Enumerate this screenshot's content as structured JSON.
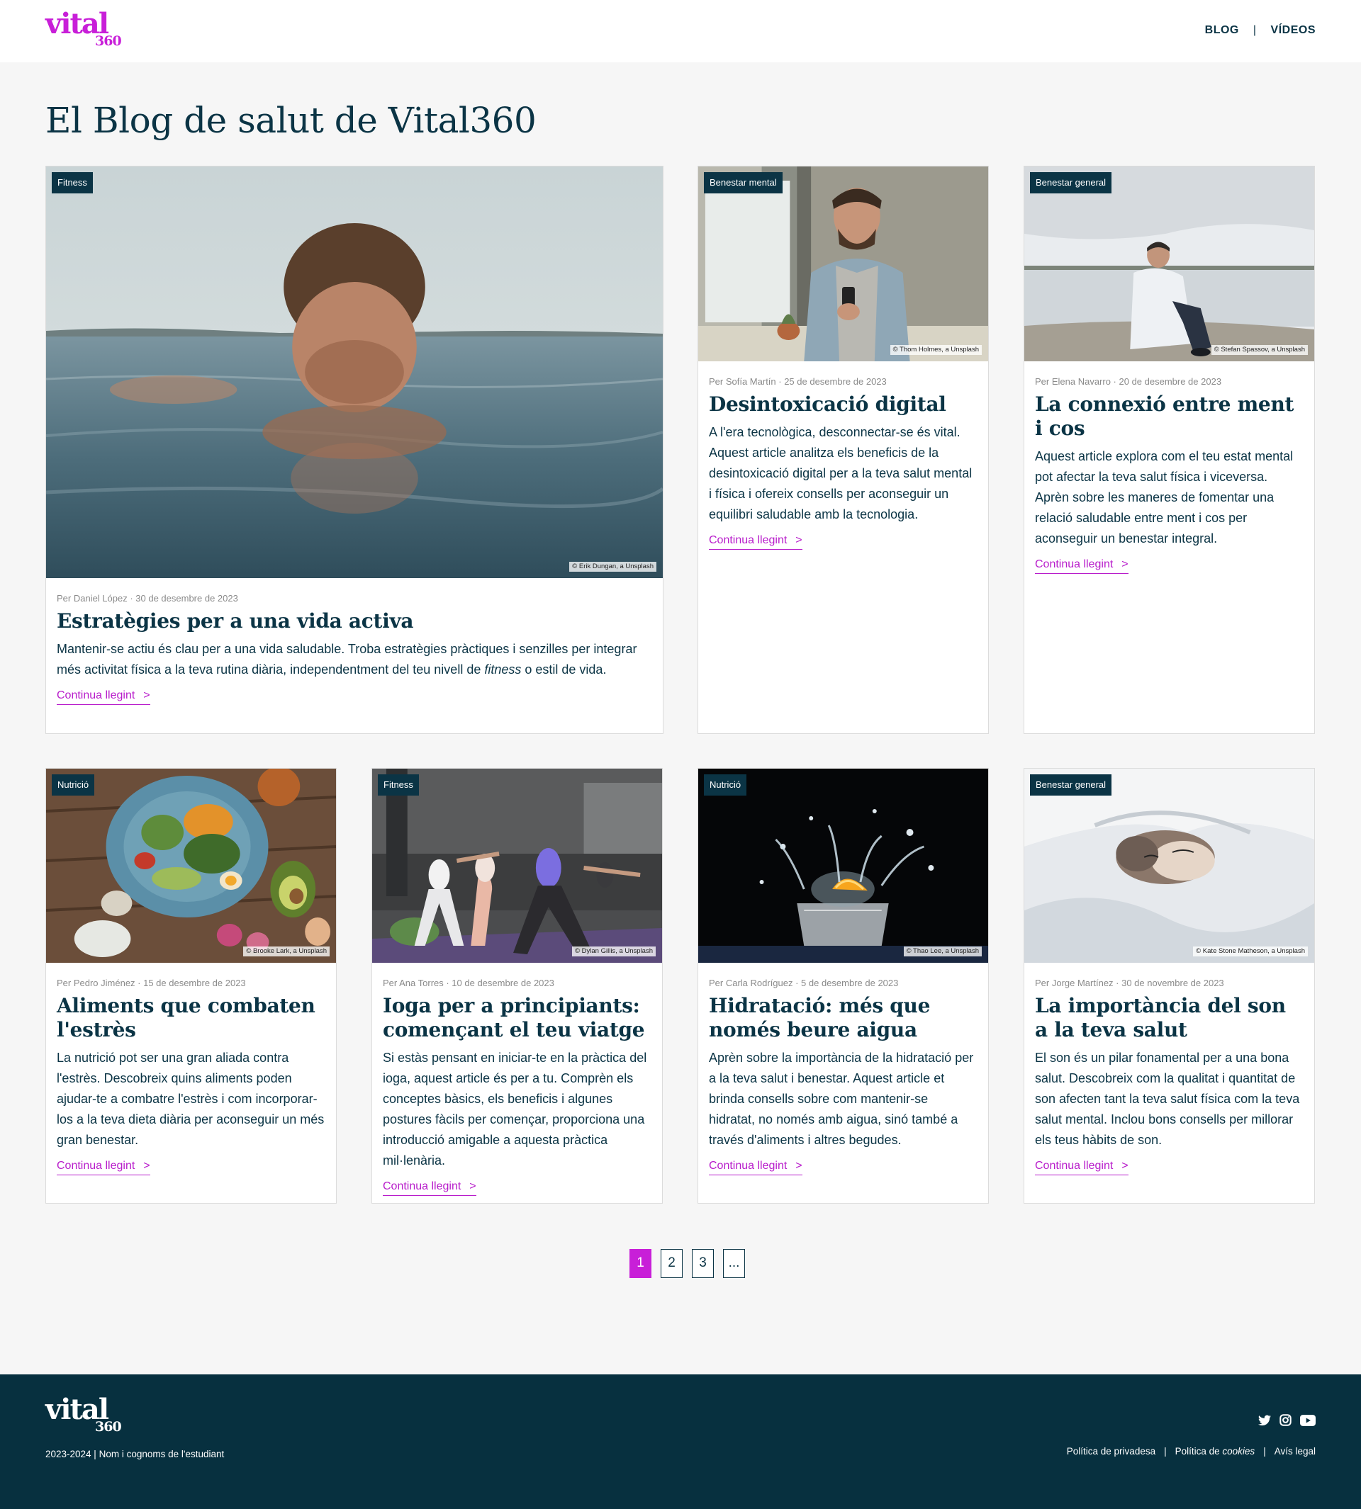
{
  "header": {
    "logo_word": "vital",
    "logo_number": "360",
    "nav": [
      {
        "label": "BLOG"
      },
      {
        "label": "VÍDEOS"
      }
    ],
    "nav_separator": "|"
  },
  "page_title": "El Blog de salut de Vital360",
  "read_more_label": "Continua llegint",
  "read_more_arrow": ">",
  "featured": {
    "category": "Fitness",
    "credit": "© Erik Dungan, a Unsplash",
    "meta": "Per Daniel López · 30 de desembre de 2023",
    "title": "Estratègies per a una vida activa",
    "text_before": "Mantenir-se actiu és clau per a una vida saludable. Troba estratègies pràctiques i senzilles per integrar més activitat física a la teva rutina diària, independentment del teu nivell de ",
    "text_italic": "fitness",
    "text_after": " o estil de vida."
  },
  "posts": [
    {
      "category": "Benestar mental",
      "credit": "© Thom Holmes, a Unsplash",
      "meta": "Per Sofía Martín · 25 de desembre de 2023",
      "title": "Desintoxicació digital",
      "text": "A l'era tecnològica, desconnectar-se és vital. Aquest article analitza els beneficis de la desintoxicació digital per a la teva salut mental i física i ofereix consells per aconseguir un equilibri saludable amb la tecnologia."
    },
    {
      "category": "Benestar general",
      "credit": "© Stefan Spassov, a Unsplash",
      "meta": "Per Elena Navarro · 20 de desembre de 2023",
      "title": "La connexió entre ment i cos",
      "text": "Aquest article explora com el teu estat mental pot afectar la teva salut física i viceversa. Aprèn sobre les maneres de fomentar una relació saludable entre ment i cos per aconseguir un benestar integral."
    },
    {
      "category": "Nutrició",
      "credit": "© Brooke Lark, a Unsplash",
      "meta": "Per Pedro Jiménez · 15 de desembre de 2023",
      "title": "Aliments que combaten l'estrès",
      "text": "La nutrició pot ser una gran aliada contra l'estrès. Descobreix quins aliments poden ajudar-te a combatre l'estrès i com incorporar-los a la teva dieta diària per aconseguir un més gran benestar."
    },
    {
      "category": "Fitness",
      "credit": "© Dylan Gillis, a Unsplash",
      "meta": "Per Ana Torres · 10 de desembre de 2023",
      "title": "Ioga per a principiants: començant el teu viatge",
      "text": "Si estàs pensant en iniciar-te en la pràctica del ioga, aquest article és per a tu. Comprèn els conceptes bàsics, els beneficis i algunes postures fàcils per començar, proporciona una introducció amigable a aquesta pràctica mil·lenària."
    },
    {
      "category": "Nutrició",
      "credit": "© Thao Lee, a Unsplash",
      "meta": "Per Carla Rodríguez · 5 de desembre de 2023",
      "title": "Hidratació: més que només beure aigua",
      "text": "Aprèn sobre la importància de la hidratació per a la teva salut i benestar. Aquest article et brinda consells sobre com mantenir-se hidratat, no només amb aigua, sinó també a través d'aliments i altres begudes."
    },
    {
      "category": "Benestar general",
      "credit": "© Kate Stone Matheson, a Unsplash",
      "meta": "Per Jorge Martínez · 30 de novembre de 2023",
      "title": "La importància del son a la teva salut",
      "text": "El son és un pilar fonamental per a una bona salut. Descobreix com la qualitat i quantitat de son afecten tant la teva salut física com la teva salut mental. Inclou bons consells per millorar els teus hàbits de son."
    }
  ],
  "pagination": {
    "pages": [
      "1",
      "2",
      "3",
      "..."
    ],
    "current": "1"
  },
  "footer": {
    "logo_word": "vital",
    "logo_number": "360",
    "copyright": "2023-2024 | Nom i cognoms de l'estudiant",
    "social_icons": [
      "twitter-icon",
      "instagram-icon",
      "youtube-icon"
    ],
    "legal": {
      "privacy": "Política de privadesa",
      "cookies_prefix": "Política de ",
      "cookies_italic": "cookies",
      "legal_notice": "Avís legal",
      "separator": "|"
    }
  },
  "colors": {
    "navy": "#0b3445",
    "accent": "#c81fd8",
    "footer_bg": "#07303f",
    "page_bg": "#f6f6f6"
  }
}
